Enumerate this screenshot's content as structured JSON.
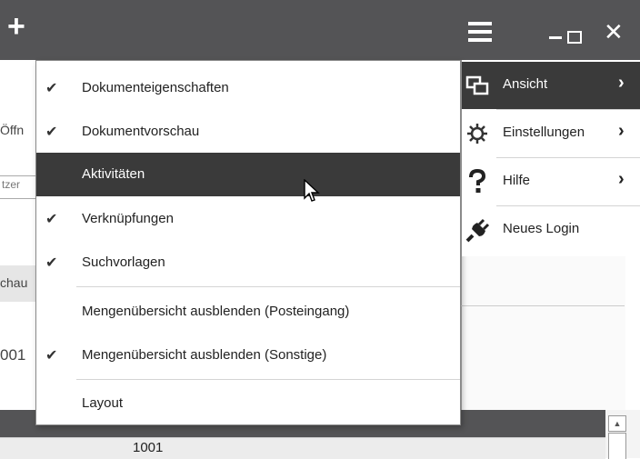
{
  "background": {
    "left_labels": [
      "Öffn",
      "tzer",
      "chau",
      "001"
    ],
    "row_value": "1001"
  },
  "view_submenu": {
    "items": [
      {
        "label": "Dokumenteigenschaften",
        "checked": true,
        "highlighted": false
      },
      {
        "label": "Dokumentvorschau",
        "checked": true,
        "highlighted": false
      },
      {
        "label": "Aktivitäten",
        "checked": false,
        "highlighted": true
      },
      {
        "label": "Verknüpfungen",
        "checked": true,
        "highlighted": false
      },
      {
        "label": "Suchvorlagen",
        "checked": true,
        "highlighted": false
      },
      {
        "label": "Mengenübersicht ausblenden (Posteingang)",
        "checked": false,
        "highlighted": false
      },
      {
        "label": "Mengenübersicht ausblenden (Sonstige)",
        "checked": true,
        "highlighted": false
      },
      {
        "label": "Layout",
        "checked": false,
        "highlighted": false
      }
    ]
  },
  "main_menu": {
    "items": [
      {
        "label": "Ansicht",
        "icon": "layout-view-icon",
        "submenu": true,
        "active": true
      },
      {
        "label": "Einstellungen",
        "icon": "settings-gear-icon",
        "submenu": true,
        "active": false
      },
      {
        "label": "Hilfe",
        "icon": "help-question-icon",
        "submenu": true,
        "active": false
      },
      {
        "label": "Neues Login",
        "icon": "plug-login-icon",
        "submenu": false,
        "active": false
      }
    ]
  },
  "glyphs": {
    "check": "✔",
    "chevron": "›",
    "plus": "+",
    "close": "✕",
    "scroll_up": "▲"
  },
  "colors": {
    "titlebar": "#545456",
    "highlight": "#3a3a3a",
    "menu_bg": "#ffffff"
  }
}
